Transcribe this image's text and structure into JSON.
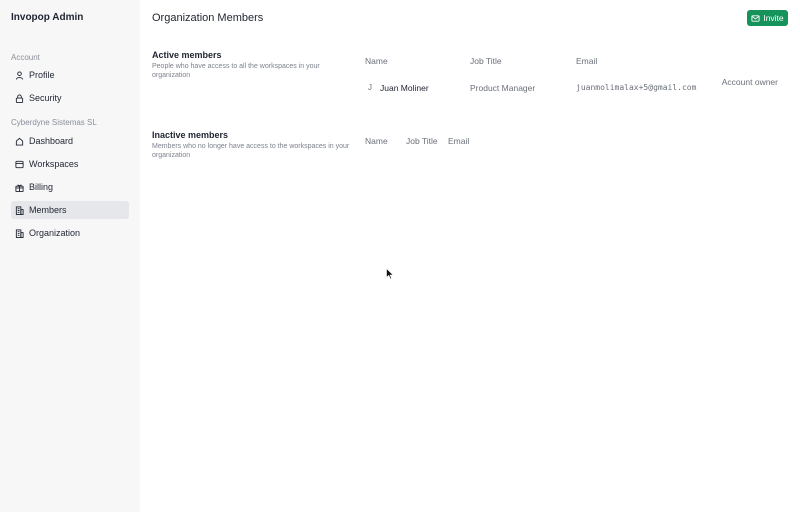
{
  "sidebar": {
    "app_title": "Invopop Admin",
    "account_label": "Account",
    "account_items": [
      {
        "label": "Profile",
        "icon": "user-icon"
      },
      {
        "label": "Security",
        "icon": "lock-icon"
      }
    ],
    "org_label": "Cyberdyne Sistemas SL",
    "org_items": [
      {
        "label": "Dashboard",
        "icon": "home-icon"
      },
      {
        "label": "Workspaces",
        "icon": "window-icon"
      },
      {
        "label": "Billing",
        "icon": "gift-icon"
      },
      {
        "label": "Members",
        "icon": "building-icon",
        "active": true
      },
      {
        "label": "Organization",
        "icon": "building-icon"
      }
    ]
  },
  "header": {
    "title": "Organization Members",
    "invite_label": "Invite",
    "invite_color": "#15935a"
  },
  "active": {
    "title": "Active members",
    "description": "People who have access to all the workspaces in your organization",
    "columns": [
      "Name",
      "Job Title",
      "Email"
    ],
    "rows": [
      {
        "initial": "J",
        "name": "Juan Moliner",
        "job_title": "Product Manager",
        "email": "juanmolimalax+5@gmail.com",
        "role": "Account owner"
      }
    ]
  },
  "inactive": {
    "title": "Inactive members",
    "description": "Members who no longer have access to the workspaces in your organization",
    "columns": [
      "Name",
      "Job Title",
      "Email"
    ]
  }
}
